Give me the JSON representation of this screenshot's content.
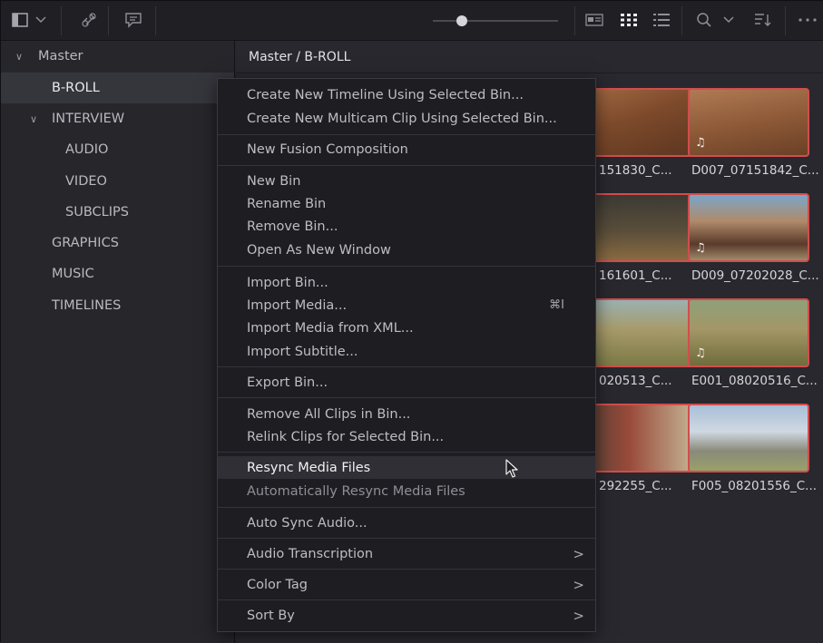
{
  "toolbar": {
    "icons": [
      "sidebar-toggle-icon",
      "chevron-down-icon",
      "unlink-icon",
      "caption-icon",
      "slider",
      "metadata-view-icon",
      "thumbnail-view-icon",
      "list-view-icon",
      "search-icon",
      "chevron-down-icon",
      "sort-icon",
      "more-icon"
    ]
  },
  "sidebar": {
    "items": [
      {
        "label": "Master",
        "arrow": "∨"
      },
      {
        "label": "B-ROLL",
        "arrow": ""
      },
      {
        "label": "INTERVIEW",
        "arrow": "∨"
      },
      {
        "label": "AUDIO",
        "arrow": ""
      },
      {
        "label": "VIDEO",
        "arrow": ""
      },
      {
        "label": "SUBCLIPS",
        "arrow": ""
      },
      {
        "label": "GRAPHICS",
        "arrow": ""
      },
      {
        "label": "MUSIC",
        "arrow": ""
      },
      {
        "label": "TIMELINES",
        "arrow": ""
      }
    ]
  },
  "content": {
    "path": "Master / B-ROLL",
    "clips": [
      {
        "label": "151830_C...",
        "audio": false
      },
      {
        "label": "D007_07151842_C...",
        "audio": true
      },
      {
        "label": "161601_C...",
        "audio": false
      },
      {
        "label": "D009_07202028_C...",
        "audio": true
      },
      {
        "label": "020513_C...",
        "audio": false
      },
      {
        "label": "E001_08020516_C...",
        "audio": true
      },
      {
        "label": "292255_C...",
        "audio": false
      },
      {
        "label": "F005_08201556_C...",
        "audio": false
      }
    ]
  },
  "menu": {
    "items": [
      {
        "label": "Create New Timeline Using Selected Bin..."
      },
      {
        "label": "Create New Multicam Clip Using Selected Bin..."
      },
      {
        "label": "New Fusion Composition"
      },
      {
        "label": "New Bin"
      },
      {
        "label": "Rename Bin"
      },
      {
        "label": "Remove Bin..."
      },
      {
        "label": "Open As New Window"
      },
      {
        "label": "Import Bin..."
      },
      {
        "label": "Import Media...",
        "shortcut": "⌘I"
      },
      {
        "label": "Import Media from XML..."
      },
      {
        "label": "Import Subtitle..."
      },
      {
        "label": "Export Bin..."
      },
      {
        "label": "Remove All Clips in Bin..."
      },
      {
        "label": "Relink Clips for Selected Bin..."
      },
      {
        "label": "Resync Media Files"
      },
      {
        "label": "Automatically Resync Media Files"
      },
      {
        "label": "Auto Sync Audio..."
      },
      {
        "label": "Audio Transcription",
        "submenu": ">"
      },
      {
        "label": "Color Tag",
        "submenu": ">"
      },
      {
        "label": "Sort By",
        "submenu": ">"
      }
    ]
  }
}
